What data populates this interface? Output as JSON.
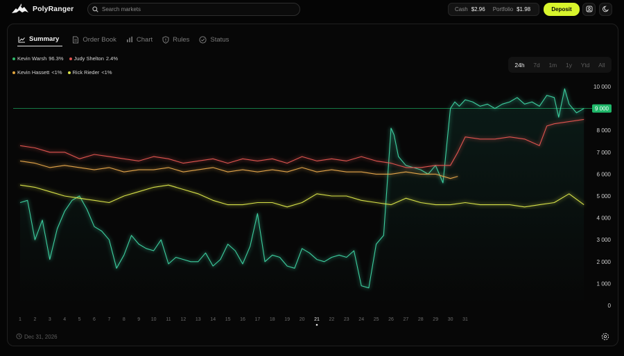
{
  "app": {
    "name": "PolyRanger"
  },
  "search": {
    "placeholder": "Search markets"
  },
  "wallet": {
    "cash_label": "Cash",
    "cash_value": "$2.96",
    "portfolio_label": "Portfolio",
    "portfolio_value": "$1.98"
  },
  "actions": {
    "deposit": "Deposit"
  },
  "icons": {
    "logo": "dragon-logo-icon",
    "search": "search-icon",
    "account": "account-icon",
    "theme": "moon-icon",
    "settings": "gear-icon",
    "date": "clock-icon"
  },
  "tabs": [
    {
      "label": "Summary",
      "icon": "line-chart-icon",
      "active": true
    },
    {
      "label": "Order Book",
      "icon": "document-icon",
      "active": false
    },
    {
      "label": "Chart",
      "icon": "bar-chart-icon",
      "active": false
    },
    {
      "label": "Rules",
      "icon": "shield-icon",
      "active": false
    },
    {
      "label": "Status",
      "icon": "check-circle-icon",
      "active": false
    }
  ],
  "legend": [
    {
      "name": "Kevin Warsh",
      "value": "96.3%",
      "color": "#2fb96b"
    },
    {
      "name": "Judy Shelton",
      "value": "2.4%",
      "color": "#e0544f"
    },
    {
      "name": "Kevin Hassett",
      "value": "<1%",
      "color": "#e0a33c"
    },
    {
      "name": "Rick Rieder",
      "value": "<1%",
      "color": "#d8e24a"
    }
  ],
  "ranges": [
    {
      "label": "24h",
      "active": true
    },
    {
      "label": "7d",
      "active": false
    },
    {
      "label": "1m",
      "active": false
    },
    {
      "label": "1y",
      "active": false
    },
    {
      "label": "Ytd",
      "active": false
    },
    {
      "label": "All",
      "active": false
    }
  ],
  "footer": {
    "date": "Dec 31, 2026"
  },
  "chart_data": {
    "type": "line",
    "ylim": [
      0,
      10000
    ],
    "y_ticks": [
      "10 000",
      "9 000",
      "8 000",
      "7 000",
      "6 000",
      "5 000",
      "4 000",
      "3 000",
      "2 000",
      "1 000",
      "0"
    ],
    "y_tick_values": [
      10000,
      9000,
      8000,
      7000,
      6000,
      5000,
      4000,
      3000,
      2000,
      1000,
      0
    ],
    "x_ticks": [
      "1",
      "2",
      "3",
      "4",
      "5",
      "6",
      "7",
      "8",
      "9",
      "10",
      "11",
      "12",
      "13",
      "14",
      "15",
      "16",
      "17",
      "18",
      "19",
      "20",
      "21",
      "22",
      "23",
      "24",
      "25",
      "26",
      "27",
      "28",
      "29",
      "30",
      "31"
    ],
    "highlighted_x": "21",
    "reference_line": {
      "value": 9000,
      "label": "9 000",
      "color": "#1fb86a"
    },
    "grid": false,
    "series": [
      {
        "name": "Kevin Warsh",
        "color": "#3ccfa0",
        "x": [
          1,
          1.5,
          2,
          2.5,
          3,
          3.5,
          4,
          4.5,
          5,
          5.5,
          6,
          6.5,
          7,
          7.5,
          8,
          8.5,
          9,
          9.5,
          10,
          10.5,
          11,
          11.5,
          12,
          12.5,
          13,
          13.5,
          14,
          14.5,
          15,
          15.5,
          16,
          16.5,
          17,
          17.5,
          18,
          18.5,
          19,
          19.5,
          20,
          20.5,
          21,
          21.5,
          22,
          22.5,
          23,
          23.5,
          24,
          24.5,
          25,
          25.5,
          26,
          26.2,
          26.5,
          27,
          27.5,
          28,
          28.5,
          29,
          29.5,
          30,
          30.3,
          30.6,
          31,
          31.5,
          32,
          32.5,
          33,
          33.5,
          34,
          34.5,
          35,
          35.5,
          36,
          36.5,
          37,
          37.3,
          37.7,
          38,
          38.5,
          39
        ],
        "y": [
          4700,
          4800,
          3000,
          3900,
          2100,
          3500,
          4300,
          4800,
          5000,
          4400,
          3600,
          3400,
          3000,
          1700,
          2300,
          3200,
          2800,
          2600,
          2500,
          3000,
          1900,
          2200,
          2100,
          2000,
          2000,
          2400,
          1800,
          2100,
          2800,
          2500,
          1900,
          2700,
          4200,
          2000,
          2300,
          2200,
          1800,
          1700,
          2600,
          2400,
          2100,
          2000,
          2200,
          2300,
          2200,
          2500,
          900,
          800,
          2800,
          3200,
          8100,
          7800,
          6800,
          6400,
          6300,
          6200,
          6000,
          6400,
          5600,
          9000,
          9300,
          9100,
          9400,
          9300,
          9100,
          9200,
          9000,
          9200,
          9300,
          9500,
          9200,
          9300,
          9100,
          9600,
          9500,
          8600,
          9900,
          9200,
          8800,
          9000
        ]
      },
      {
        "name": "Judy Shelton",
        "color": "#e0544f",
        "x": [
          1,
          2,
          3,
          4,
          5,
          6,
          7,
          8,
          9,
          10,
          11,
          12,
          13,
          14,
          15,
          16,
          17,
          18,
          19,
          20,
          21,
          22,
          23,
          24,
          25,
          26,
          27,
          28,
          29,
          30,
          30.5,
          31,
          32,
          33,
          34,
          35,
          36,
          36.5,
          37,
          38,
          39
        ],
        "y": [
          7300,
          7200,
          7000,
          7000,
          6700,
          6900,
          6800,
          6700,
          6600,
          6800,
          6700,
          6500,
          6600,
          6700,
          6500,
          6700,
          6600,
          6700,
          6500,
          6800,
          6600,
          6700,
          6600,
          6800,
          6600,
          6500,
          6300,
          6300,
          6400,
          6400,
          7000,
          7700,
          7600,
          7600,
          7700,
          7600,
          7300,
          8200,
          8300,
          8400,
          8500
        ]
      },
      {
        "name": "Kevin Hassett",
        "color": "#e2a44a",
        "x": [
          1,
          2,
          3,
          4,
          5,
          6,
          7,
          8,
          9,
          10,
          11,
          12,
          13,
          14,
          15,
          16,
          17,
          18,
          19,
          20,
          21,
          22,
          23,
          24,
          25,
          26,
          27,
          28,
          29,
          30,
          30.5
        ],
        "y": [
          6600,
          6500,
          6300,
          6400,
          6300,
          6200,
          6300,
          6100,
          6200,
          6200,
          6300,
          6100,
          6200,
          6300,
          6100,
          6200,
          6100,
          6200,
          6100,
          6300,
          6100,
          6200,
          6100,
          6100,
          6000,
          6000,
          6100,
          6000,
          6000,
          5800,
          5900
        ]
      },
      {
        "name": "Rick Rieder",
        "color": "#d8e24a",
        "x": [
          1,
          2,
          3,
          4,
          5,
          6,
          7,
          8,
          9,
          10,
          11,
          12,
          13,
          14,
          15,
          16,
          17,
          18,
          19,
          20,
          21,
          22,
          23,
          24,
          25,
          26,
          27,
          28,
          29,
          30,
          31,
          32,
          33,
          34,
          35,
          36,
          37,
          38,
          39
        ],
        "y": [
          5500,
          5400,
          5200,
          5000,
          4900,
          4800,
          4700,
          5000,
          5200,
          5400,
          5500,
          5300,
          5100,
          4800,
          4600,
          4600,
          4700,
          4700,
          4500,
          4700,
          5100,
          5000,
          5000,
          4800,
          4700,
          4600,
          4900,
          4700,
          4600,
          4600,
          4700,
          4600,
          4600,
          4600,
          4500,
          4600,
          4700,
          5100,
          4600
        ]
      }
    ]
  }
}
